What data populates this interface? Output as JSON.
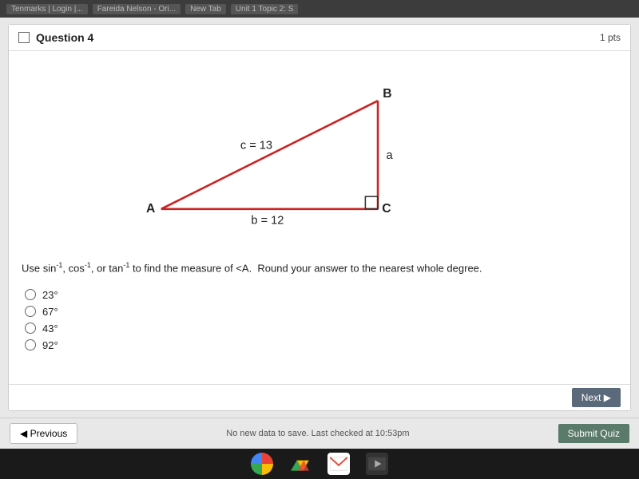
{
  "browser": {
    "bar_items": [
      "Tenmarks | Login |...",
      "Fareida Nelson - Ori...",
      "New Tab",
      "Unit 1 Topic 2: S"
    ]
  },
  "question": {
    "number": "Question 4",
    "points": "1 pts",
    "triangle": {
      "vertex_a": "A",
      "vertex_b": "B",
      "vertex_c": "C",
      "side_c_label": "c = 13",
      "side_b_label": "b = 12",
      "side_a_label": "a"
    },
    "question_text": "Use sin⁻¹, cos⁻¹, or tan⁻¹ to find the measure of <A.  Round your answer to the nearest whole degree.",
    "options": [
      {
        "id": "opt1",
        "label": "23°"
      },
      {
        "id": "opt2",
        "label": "67°"
      },
      {
        "id": "opt3",
        "label": "43°"
      },
      {
        "id": "opt4",
        "label": "92°"
      }
    ]
  },
  "nav": {
    "next_label": "Next ▶",
    "previous_label": "◀ Previous",
    "status_text": "No new data to save. Last checked at 10:53pm",
    "submit_label": "Submit Quiz"
  },
  "taskbar": {
    "icons": [
      "chrome",
      "drive",
      "gmail",
      "video"
    ]
  }
}
